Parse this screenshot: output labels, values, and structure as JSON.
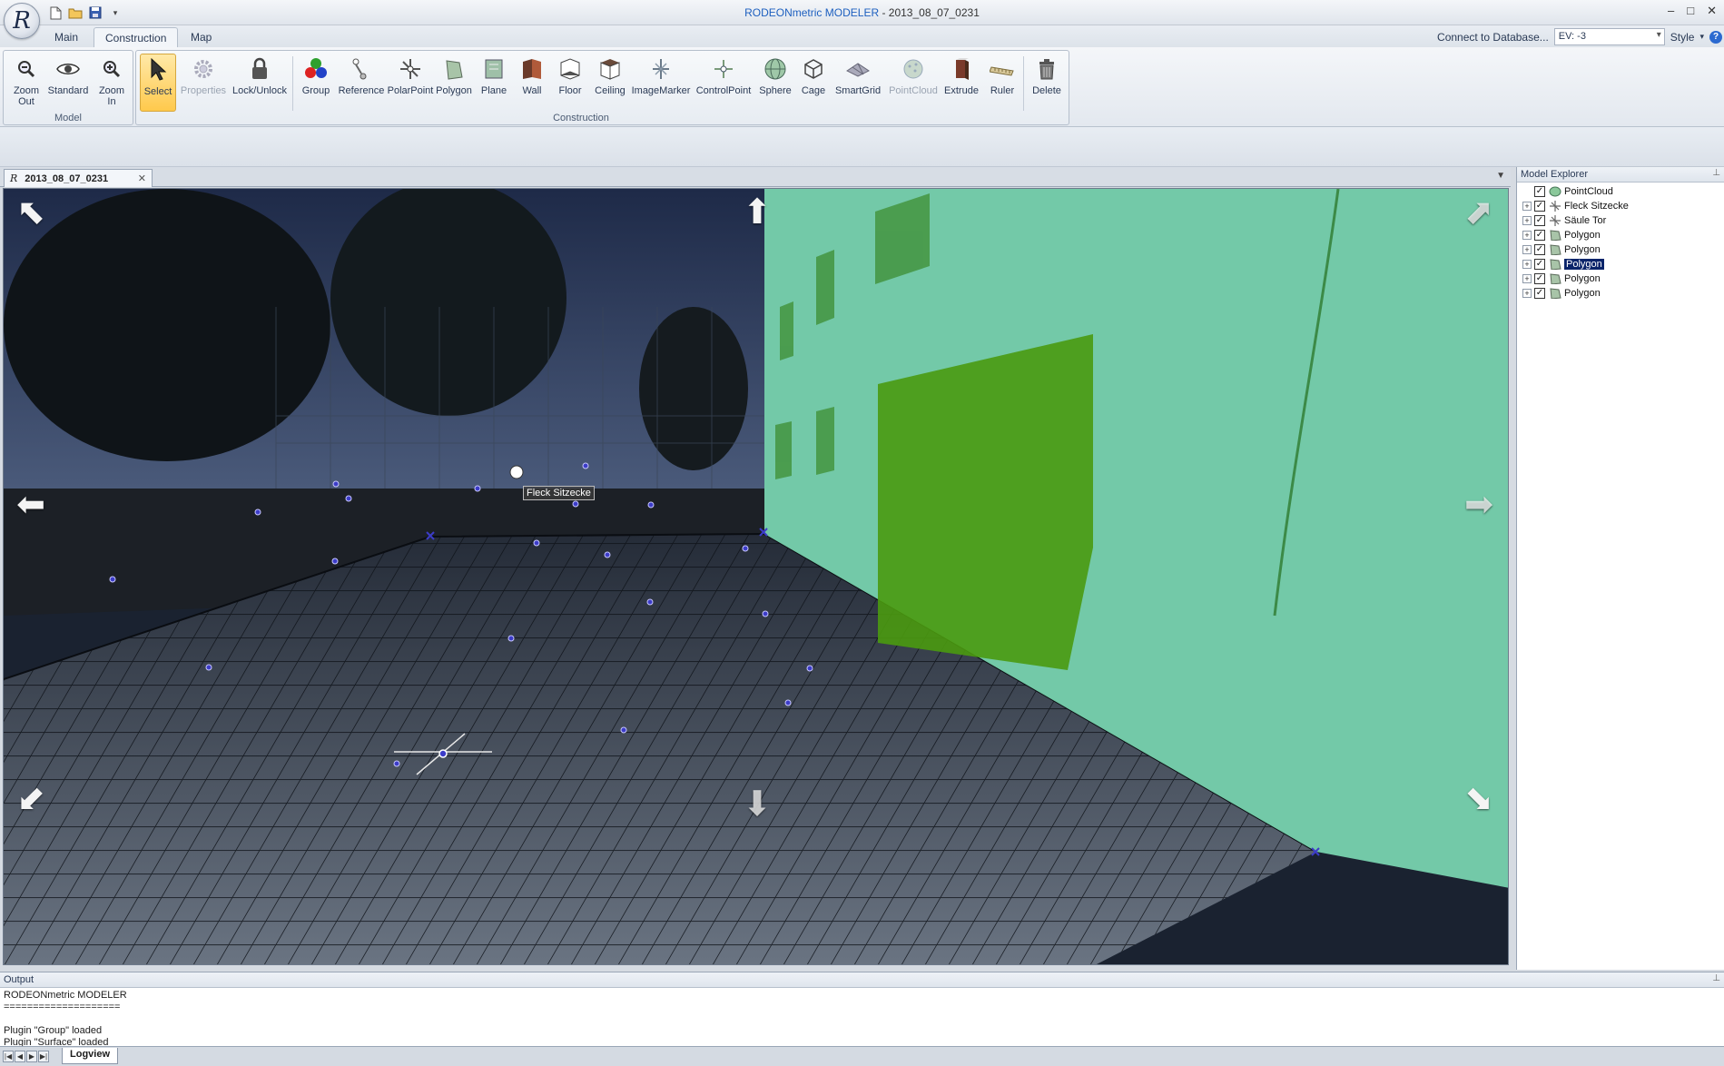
{
  "app": {
    "title": "RODEONmetric MODELER",
    "title_suffix": " - 2013_08_07_0231",
    "logo_letter": "R"
  },
  "window_controls": [
    "–",
    "□",
    "✕"
  ],
  "ribbon_tabs": [
    {
      "label": "Main",
      "active": false
    },
    {
      "label": "Construction",
      "active": true
    },
    {
      "label": "Map",
      "active": false
    }
  ],
  "right_tools": {
    "connect_label": "Connect to Database...",
    "ev_value": "EV: -3",
    "style_label": "Style"
  },
  "groups": {
    "model": {
      "label": "Model",
      "buttons": [
        "Zoom\nOut",
        "Standard",
        "Zoom\nIn"
      ]
    },
    "construction": {
      "label": "Construction",
      "buttons": [
        {
          "label": "Select",
          "state": "active"
        },
        {
          "label": "Properties",
          "state": "disabled"
        },
        {
          "label": "Lock/Unlock",
          "state": "normal"
        },
        {
          "label": "Group",
          "state": "normal"
        },
        {
          "label": "Reference",
          "state": "normal"
        },
        {
          "label": "PolarPoint",
          "state": "normal"
        },
        {
          "label": "Polygon",
          "state": "normal"
        },
        {
          "label": "Plane",
          "state": "normal"
        },
        {
          "label": "Wall",
          "state": "normal"
        },
        {
          "label": "Floor",
          "state": "normal"
        },
        {
          "label": "Ceiling",
          "state": "normal"
        },
        {
          "label": "ImageMarker",
          "state": "normal"
        },
        {
          "label": "ControlPoint",
          "state": "normal"
        },
        {
          "label": "Sphere",
          "state": "normal"
        },
        {
          "label": "Cage",
          "state": "normal"
        },
        {
          "label": "SmartGrid",
          "state": "normal"
        },
        {
          "label": "PointCloud",
          "state": "disabled"
        },
        {
          "label": "Extrude",
          "state": "normal"
        },
        {
          "label": "Ruler",
          "state": "normal"
        }
      ]
    },
    "delete": {
      "label": "Delete"
    }
  },
  "document": {
    "tab_label": "2013_08_07_0231",
    "point_label": "Fleck Sitzecke"
  },
  "explorer": {
    "title": "Model Explorer",
    "items": [
      {
        "label": "PointCloud",
        "expandable": false,
        "checked": true,
        "icon": "pointcloud-icon",
        "selected": false
      },
      {
        "label": "Fleck Sitzecke",
        "expandable": true,
        "checked": true,
        "icon": "point-icon",
        "selected": false
      },
      {
        "label": "Säule Tor",
        "expandable": true,
        "checked": true,
        "icon": "point-icon",
        "selected": false
      },
      {
        "label": "Polygon",
        "expandable": true,
        "checked": true,
        "icon": "polygon-icon",
        "selected": false
      },
      {
        "label": "Polygon",
        "expandable": true,
        "checked": true,
        "icon": "polygon-icon",
        "selected": false
      },
      {
        "label": "Polygon",
        "expandable": true,
        "checked": true,
        "icon": "polygon-icon",
        "selected": true
      },
      {
        "label": "Polygon",
        "expandable": true,
        "checked": true,
        "icon": "polygon-icon",
        "selected": false
      },
      {
        "label": "Polygon",
        "expandable": true,
        "checked": true,
        "icon": "polygon-icon",
        "selected": false
      }
    ]
  },
  "output": {
    "title": "Output",
    "lines": [
      "RODEONmetric MODELER",
      "====================",
      "",
      "Plugin \"Group\" loaded",
      "Plugin \"Surface\" loaded"
    ],
    "tab_label": "Logview"
  },
  "colors": {
    "accent": "#1d5fbf",
    "selected_tab": "#ffc94c",
    "wall_overlay": "#7fe0b8",
    "window_overlay": "#4a9a10"
  }
}
